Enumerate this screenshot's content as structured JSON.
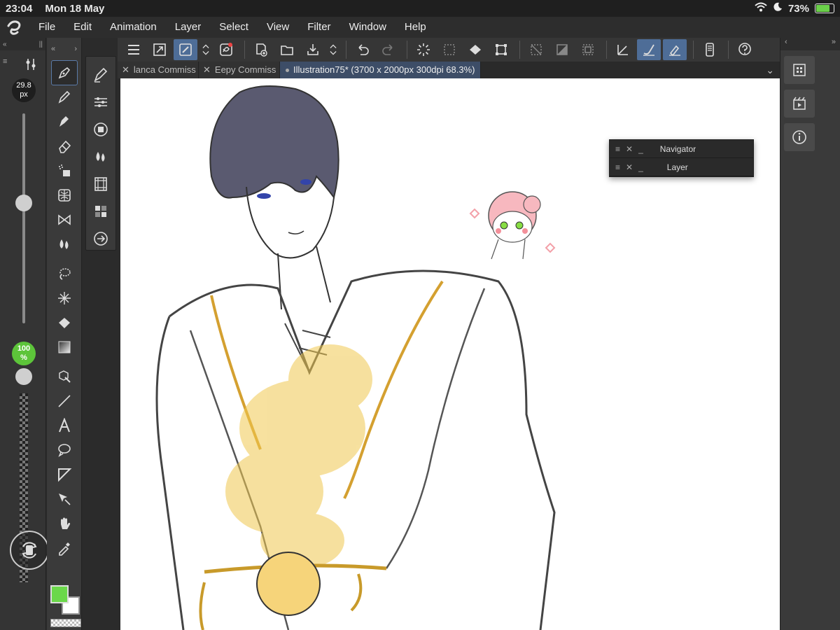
{
  "status_bar": {
    "time": "23:04",
    "date": "Mon 18 May",
    "battery": "73%"
  },
  "menu": [
    "File",
    "Edit",
    "Animation",
    "Layer",
    "Select",
    "View",
    "Filter",
    "Window",
    "Help"
  ],
  "brush": {
    "size_value": "29.8",
    "size_unit": "px",
    "opacity_value": "100",
    "opacity_unit": "%"
  },
  "tabs": [
    {
      "label": "lanca Commiss"
    },
    {
      "label": "Eepy Commiss"
    },
    {
      "label": "Illustration75* (3700 x 2000px 300dpi 68.3%)"
    }
  ],
  "floating_panel": {
    "navigator": "Navigator",
    "layer": "Layer"
  },
  "colors": {
    "main": "#6bd84a",
    "sub": "#ffffff",
    "accent": "#4e6d97"
  },
  "icons": [
    "app-logo",
    "menu",
    "fullscreen",
    "edit-tool",
    "updown",
    "special-ruler",
    "new-layer",
    "open-folder",
    "save",
    "undo",
    "redo",
    "selection-spin",
    "deselect",
    "fill",
    "transform",
    "hide-selection",
    "gradient",
    "border",
    "pen-tool",
    "brush",
    "erase"
  ]
}
